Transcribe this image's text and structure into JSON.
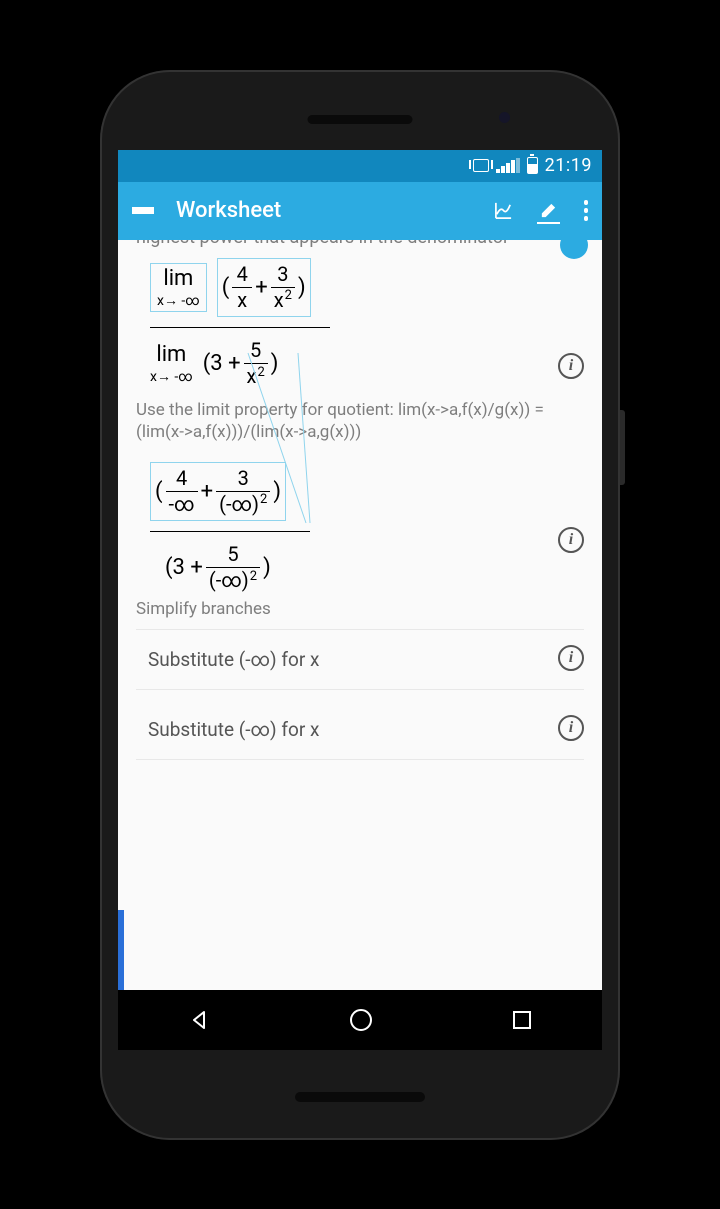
{
  "status_bar": {
    "time": "21:19"
  },
  "app_bar": {
    "title": "Worksheet"
  },
  "content": {
    "partial_hint": "highest power that appears in the denominator",
    "expr1": {
      "lim_label": "lim",
      "lim_sub": "x→ -∞",
      "num1": "4",
      "den1": "x",
      "plus": "+",
      "num2": "3",
      "den2_base": "x",
      "den2_exp": "2"
    },
    "expr2": {
      "lim_label": "lim",
      "lim_sub": "x→ -∞",
      "three": "3",
      "plus": "+",
      "num": "5",
      "den_base": "x",
      "den_exp": "2"
    },
    "step1_text": "Use the limit property for quotient:  lim(x->a,f(x)/g(x)) = (lim(x->a,f(x)))/(lim(x->a,g(x)))",
    "expr3": {
      "num1": "4",
      "den1": "-∞",
      "plus": "+",
      "num2": "3",
      "den2_base": "(-∞)",
      "den2_exp": "2"
    },
    "expr4": {
      "three": "3",
      "plus": "+",
      "num": "5",
      "den_base": "(-∞)",
      "den_exp": "2"
    },
    "step2_text": "Simplify  branches",
    "substep1": "Substitute (-∞)  for  x",
    "substep2": "Substitute (-∞)  for  x"
  }
}
